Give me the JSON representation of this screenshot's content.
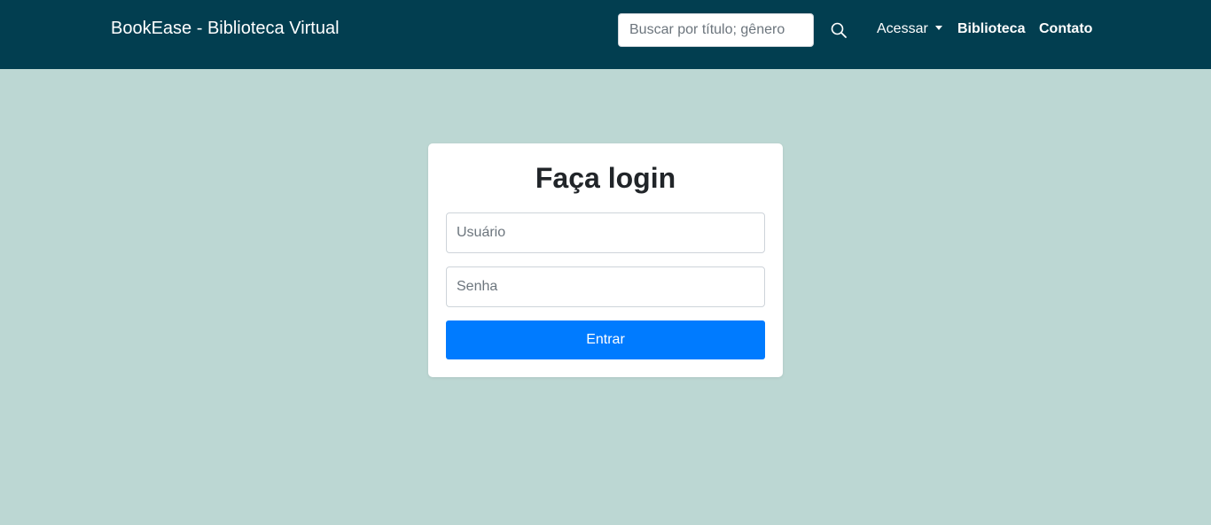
{
  "navbar": {
    "brand": "BookEase - Biblioteca Virtual",
    "search_placeholder": "Buscar por título; gênero",
    "search_icon": "search-icon",
    "links": {
      "acessar": "Acessar",
      "biblioteca": "Biblioteca",
      "contato": "Contato"
    }
  },
  "login": {
    "title": "Faça login",
    "username_placeholder": "Usuário",
    "password_placeholder": "Senha",
    "submit_label": "Entrar"
  },
  "colors": {
    "navbar_bg": "#023e50",
    "page_bg": "#bcd7d3",
    "primary_button": "#007bff"
  }
}
